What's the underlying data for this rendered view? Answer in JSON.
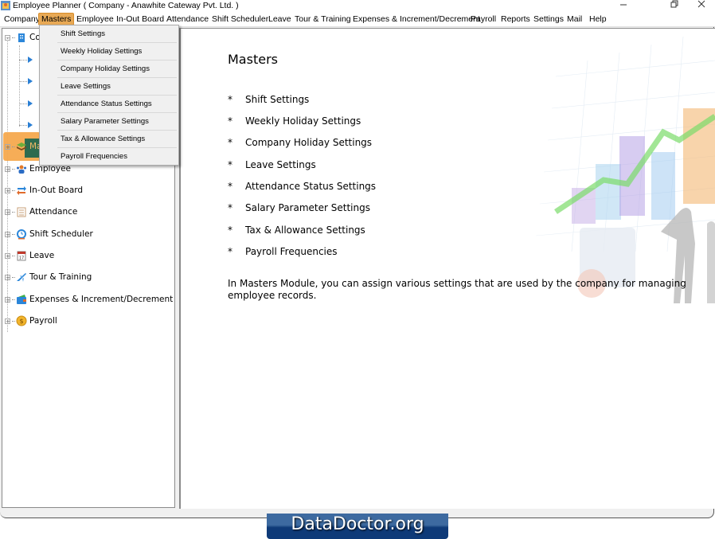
{
  "window": {
    "title": "Employee Planner ( Company - Anawhite Cateway Pvt. Ltd. )",
    "controls": [
      "minimize",
      "restore",
      "close"
    ]
  },
  "menubar": {
    "items": [
      {
        "label": "Company"
      },
      {
        "label": "Masters",
        "active": true
      },
      {
        "label": "Employee"
      },
      {
        "label": "In-Out Board"
      },
      {
        "label": "Attendance"
      },
      {
        "label": "Shift Scheduler"
      },
      {
        "label": "Leave"
      },
      {
        "label": "Tour & Training"
      },
      {
        "label": "Expenses & Increment/Decrement"
      },
      {
        "label": "Payroll"
      },
      {
        "label": "Reports"
      },
      {
        "label": "Settings"
      },
      {
        "label": "Mail"
      },
      {
        "label": "Help"
      }
    ]
  },
  "masters_menu": {
    "items": [
      "Shift Settings",
      "Weekly Holiday Settings",
      "Company Holiday Settings",
      "Leave Settings",
      "Attendance Status Settings",
      "Salary Parameter Settings",
      "Tax & Allowance Settings",
      "Payroll Frequencies"
    ]
  },
  "tree": {
    "company_label": "Co",
    "masters_label": "Ma",
    "items": [
      {
        "label": "Employee",
        "icon": "employee-icon"
      },
      {
        "label": "In-Out Board",
        "icon": "in-out-icon"
      },
      {
        "label": "Attendance",
        "icon": "attendance-icon"
      },
      {
        "label": "Shift Scheduler",
        "icon": "clock-icon"
      },
      {
        "label": "Leave",
        "icon": "calendar-icon"
      },
      {
        "label": "Tour & Training",
        "icon": "airplane-icon"
      },
      {
        "label": "Expenses & Increment/Decrement",
        "icon": "wallet-icon"
      },
      {
        "label": "Payroll",
        "icon": "coin-icon"
      }
    ]
  },
  "content": {
    "title": "Masters",
    "bullet": "*",
    "items": [
      "Shift Settings",
      "Weekly Holiday Settings",
      "Company Holiday Settings",
      "Leave Settings",
      "Attendance Status Settings",
      "Salary Parameter Settings",
      "Tax & Allowance Settings",
      "Payroll Frequencies"
    ],
    "description": "In Masters Module, you can assign various settings that are used by the company for managing employee records."
  },
  "branding": {
    "text": "DataDoctor.org"
  }
}
